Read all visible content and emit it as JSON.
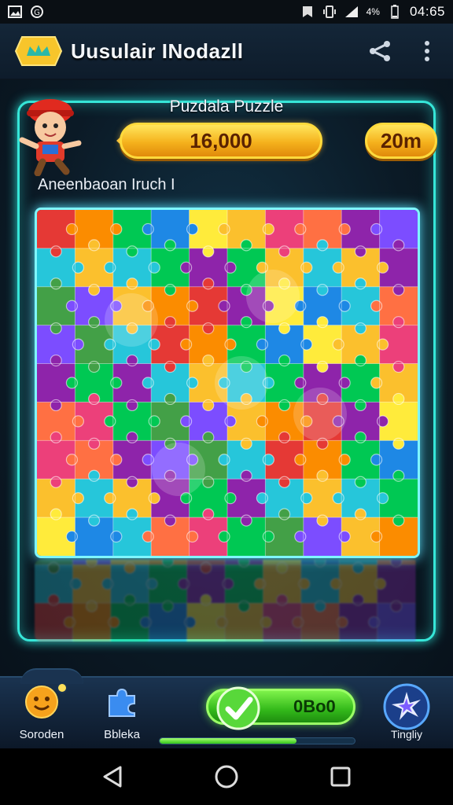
{
  "status_bar": {
    "time": "04:65",
    "battery": "4%",
    "icons": [
      "image-icon",
      "data-saver-icon",
      "notification-icon",
      "vibrate-icon",
      "signal-icon",
      "battery-icon"
    ]
  },
  "header": {
    "title": "Uusulair INodazll",
    "logo_icon": "crown-logo-icon",
    "actions": [
      "share-icon",
      "more-vert-icon"
    ]
  },
  "game": {
    "puzzle_name": "Puzdala Puzzle",
    "score": "16,000",
    "time": "20m",
    "subtitle": "Aneenbaoan Iruch I",
    "board": {
      "rows": 9,
      "cols": 10,
      "palette": [
        "#e53935",
        "#fbc02d",
        "#43a047",
        "#1e88e5",
        "#8e24aa",
        "#fb8c00",
        "#ec407a",
        "#26c6da",
        "#ffeb3b",
        "#7c4dff",
        "#00c853",
        "#ff7043"
      ]
    }
  },
  "bottom_bar": {
    "nav": [
      {
        "label": "Soroden",
        "icon": "smiley-icon"
      },
      {
        "label": "Bbleka",
        "icon": "puzzle-piece-icon"
      }
    ],
    "check_value": "0Bo0",
    "progress": 0.7,
    "tingly_label": "Tingliy",
    "tingly_icon": "star-burst-icon"
  },
  "colors": {
    "accent_cyan": "#36e6d8",
    "pill_gold": "#f5b21d",
    "green": "#33b91a"
  }
}
